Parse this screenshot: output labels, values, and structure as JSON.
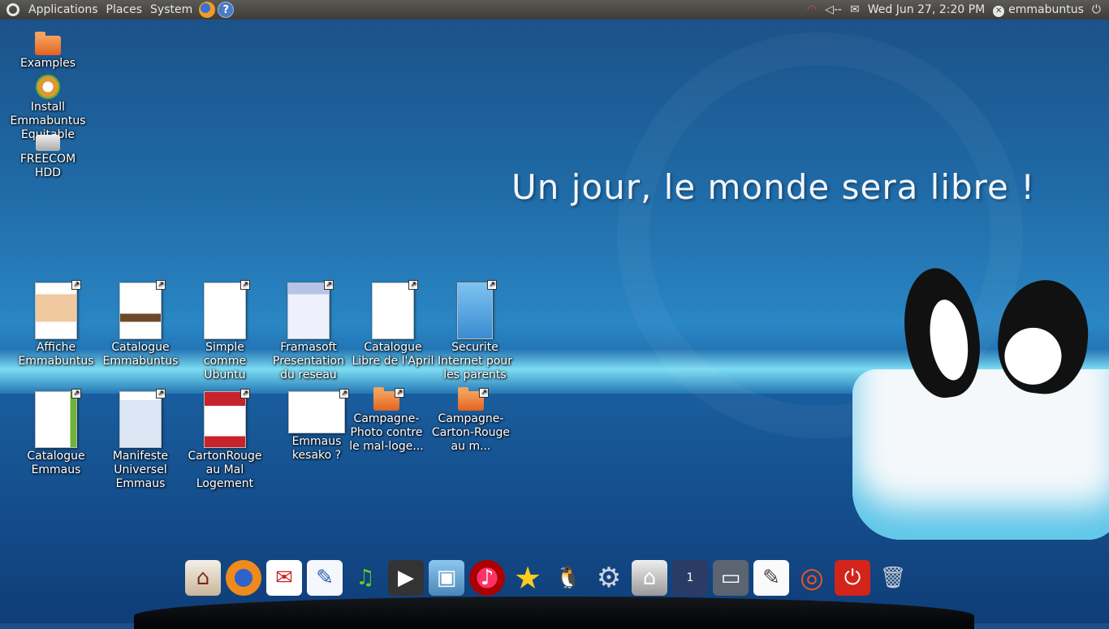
{
  "top_panel": {
    "menus": [
      "Applications",
      "Places",
      "System"
    ],
    "clock": "Wed Jun 27,  2:20 PM",
    "user": "emmabuntus",
    "volume_label": "◁--"
  },
  "desktop": {
    "slogan": "Un jour, le monde sera libre !",
    "top_icons": [
      {
        "label": "Examples"
      },
      {
        "label": "Install Emmabuntus Equitable"
      },
      {
        "label": "FREECOM HDD"
      }
    ],
    "row1": [
      {
        "label": "Affiche Emmabuntus"
      },
      {
        "label": "Catalogue Emmabuntus"
      },
      {
        "label": "Simple comme Ubuntu"
      },
      {
        "label": "Framasoft Presentation du reseau"
      },
      {
        "label": "Catalogue Libre de l'April"
      },
      {
        "label": "Securite Internet pour les parents"
      }
    ],
    "row2": [
      {
        "label": "Catalogue Emmaus"
      },
      {
        "label": "Manifeste Universel Emmaus"
      },
      {
        "label": "CartonRouge au Mal Logement"
      },
      {
        "label": "Emmaus kesako ?"
      },
      {
        "label": "Campagne-Photo contre le mal-loge..."
      },
      {
        "label": "Campagne-Carton-Rouge au m..."
      }
    ]
  },
  "dock": {
    "apps": [
      "home-icon",
      "firefox-icon",
      "mail-icon",
      "writer-icon",
      "music-icon",
      "video-icon",
      "photos-icon",
      "media-player-icon",
      "favorites-icon",
      "tux-icon",
      "settings-icon",
      "security-icon",
      "workspace-icon",
      "window-icon",
      "editor-icon",
      "ubuntu-icon",
      "power-icon",
      "trash-icon"
    ]
  }
}
